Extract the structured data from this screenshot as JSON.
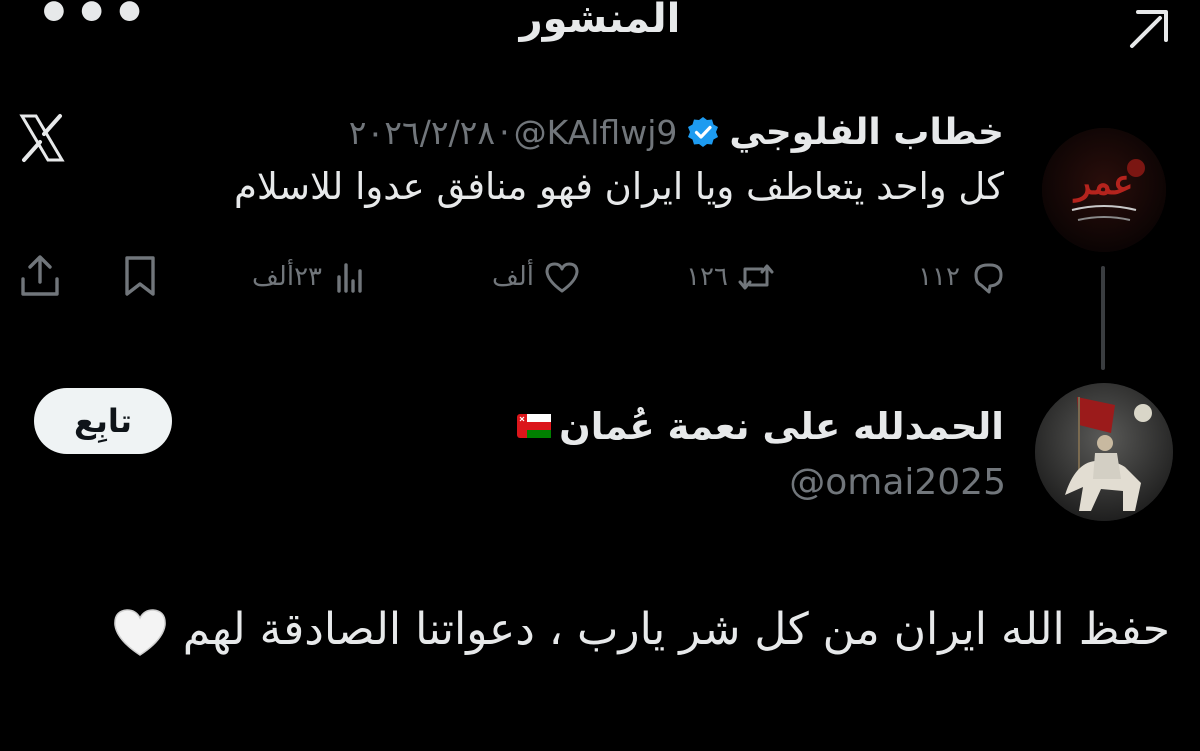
{
  "header": {
    "title": "المنشور",
    "more_label": "•••"
  },
  "quoted_tweet": {
    "display_name": "خطاب الفلوجي",
    "handle": "@KAlflwj9",
    "separator": "·",
    "date": "٢٠٢٦/٢/٢٨",
    "text": "كل واحد يتعاطف ويا ايران فهو  منافق عدوا للاسلام",
    "avatar_caption": "عمر",
    "stats": {
      "replies": "١١٢",
      "reposts": "١٢٦",
      "likes": "ألف",
      "views": "٢٣ألف"
    }
  },
  "reply_tweet": {
    "display_name": "الحمدلله على نعمة عُمان",
    "handle": "@omai2025",
    "follow_label": "تابِع",
    "text": "حفظ الله ايران من كل شر يارب ، دعواتنا الصادقة لهم"
  },
  "icons": {
    "more": "more-icon",
    "share_top": "share-icon",
    "verified": "verified-badge-icon",
    "x_logo": "x-logo-icon",
    "reply": "reply-icon",
    "repost": "repost-icon",
    "like": "heart-icon",
    "views": "views-icon",
    "bookmark": "bookmark-icon",
    "share": "share-icon",
    "flag": "oman-flag-icon",
    "emoji": "white-heart-emoji"
  },
  "colors": {
    "background": "#000000",
    "text": "#e7e9ea",
    "muted": "#71767b",
    "verified": "#1d9bf0",
    "button_bg": "#eff3f4"
  }
}
